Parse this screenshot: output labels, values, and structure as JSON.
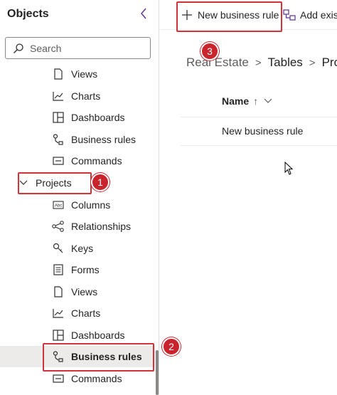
{
  "panel": {
    "title": "Objects",
    "search_placeholder": "Search"
  },
  "tree": {
    "upper_items": [
      {
        "label": "Views",
        "icon": "views-icon"
      },
      {
        "label": "Charts",
        "icon": "chart-icon"
      },
      {
        "label": "Dashboards",
        "icon": "dashboard-icon"
      },
      {
        "label": "Business rules",
        "icon": "business-rule-icon"
      },
      {
        "label": "Commands",
        "icon": "command-icon"
      }
    ],
    "group": {
      "label": "Projects",
      "expanded": true
    },
    "group_items": [
      {
        "label": "Columns",
        "icon": "columns-icon"
      },
      {
        "label": "Relationships",
        "icon": "relationships-icon"
      },
      {
        "label": "Keys",
        "icon": "key-icon"
      },
      {
        "label": "Forms",
        "icon": "form-icon"
      },
      {
        "label": "Views",
        "icon": "views-icon"
      },
      {
        "label": "Charts",
        "icon": "chart-icon"
      },
      {
        "label": "Dashboards",
        "icon": "dashboard-icon"
      },
      {
        "label": "Business rules",
        "icon": "business-rule-icon",
        "selected": true
      },
      {
        "label": "Commands",
        "icon": "command-icon"
      }
    ]
  },
  "toolbar": {
    "new_rule_label": "New business rule",
    "add_existing_label": "Add exis"
  },
  "breadcrumb": {
    "items": [
      "Real Estate",
      "Tables",
      "Proj"
    ]
  },
  "grid": {
    "column_name": "Name",
    "sort_indicator": "↑",
    "rows": [
      "New business rule"
    ]
  },
  "annotations": {
    "badge1": "1",
    "badge2": "2",
    "badge3": "3",
    "highlight_color": "#d0343a",
    "badge_color": "#c9232c"
  }
}
